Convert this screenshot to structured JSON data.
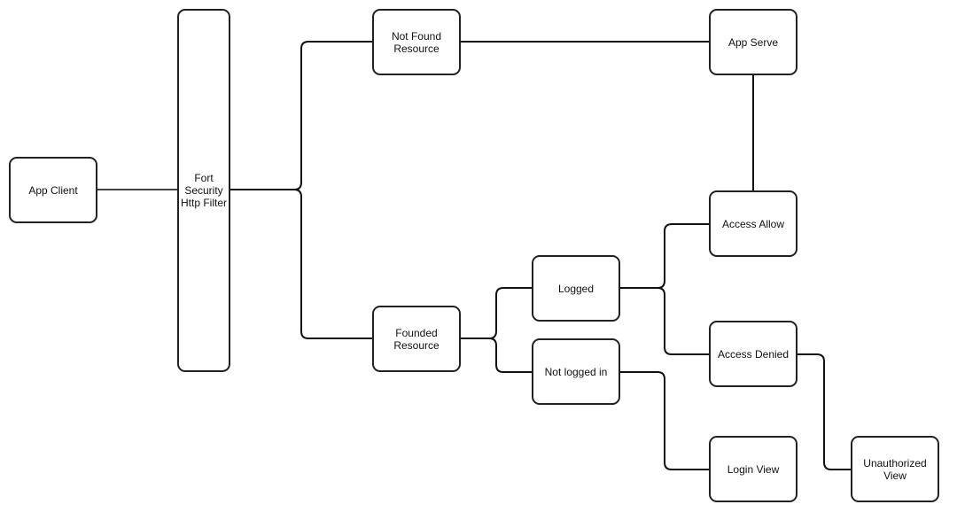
{
  "nodes": {
    "app_client": "App Client",
    "filter": "Fort\nSecurity\nHttp Filter",
    "not_found": "Not Found\nResource",
    "app_serve": "App Serve",
    "founded": "Founded\nResource",
    "logged": "Logged",
    "not_logged": "Not logged in",
    "access_allow": "Access Allow",
    "access_denied": "Access Denied",
    "login_view": "Login View",
    "unauthorized_view": "Unauthorized\nView"
  },
  "colors": {
    "stroke": "#111111",
    "background": "#ffffff"
  }
}
